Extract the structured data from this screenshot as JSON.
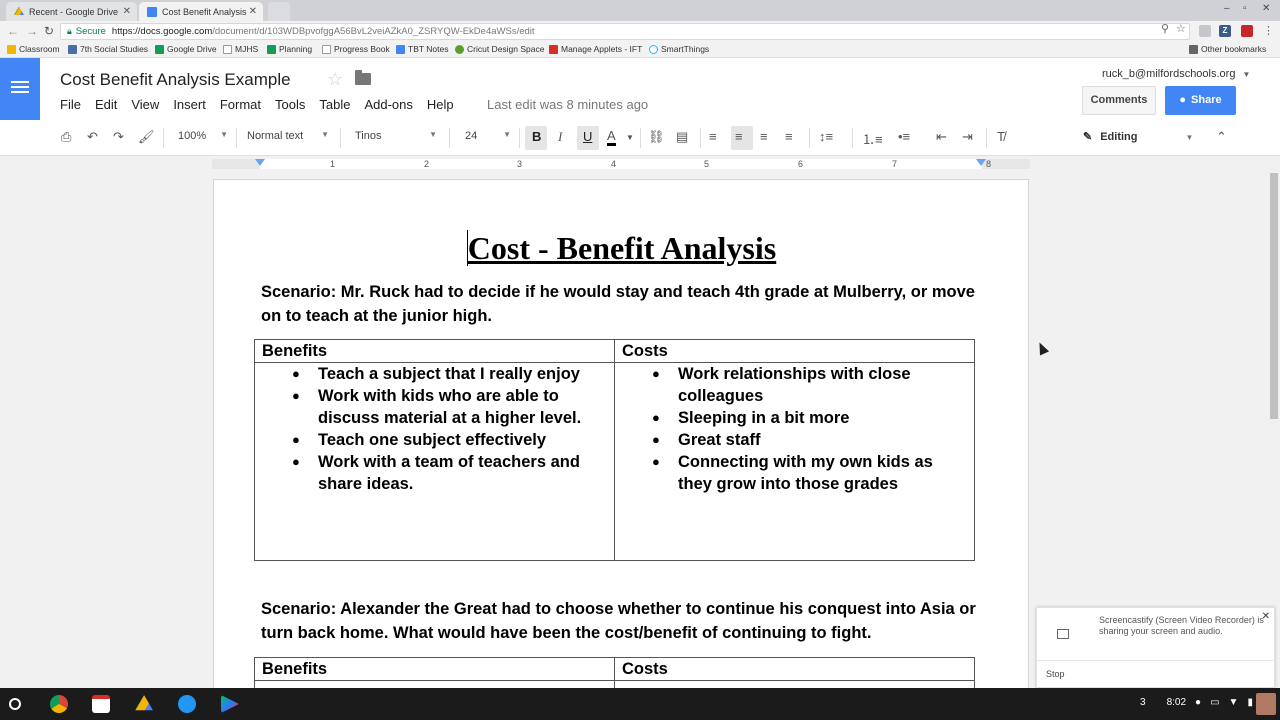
{
  "browser": {
    "tabs": [
      {
        "title": "Recent - Google Drive",
        "favicon": "google-drive-icon",
        "active": false
      },
      {
        "title": "Cost Benefit Analysis Ex",
        "favicon": "google-docs-icon",
        "active": true
      }
    ],
    "url_secure_label": "Secure",
    "url_host": "https://docs.google.com",
    "url_path": "/document/d/103WDBpvofggA56BvL2veiAZkA0_ZSRYQW-EkDe4aWSs/edit",
    "bookmarks": [
      {
        "label": "Classroom",
        "icon": "classroom-icon",
        "color": "#f4b400"
      },
      {
        "label": "7th Social Studies",
        "icon": "z-icon",
        "color": "#4a6fa5"
      },
      {
        "label": "Google Drive",
        "icon": "google-drive-icon",
        "color": "#0f9d58"
      },
      {
        "label": "MJHS",
        "icon": "page-icon",
        "color": "#9e9e9e"
      },
      {
        "label": "Planning",
        "icon": "google-drive-icon",
        "color": "#0f9d58"
      },
      {
        "label": "Progress Book",
        "icon": "page-icon",
        "color": "#9e9e9e"
      },
      {
        "label": "TBT Notes",
        "icon": "docs-icon",
        "color": "#4285f4"
      },
      {
        "label": "Cricut Design Space",
        "icon": "cricut-icon",
        "color": "#5aa02c"
      },
      {
        "label": "Manage Applets - IFT",
        "icon": "ifttt-icon",
        "color": "#d93025"
      },
      {
        "label": "SmartThings",
        "icon": "smartthings-icon",
        "color": "#15bfff"
      }
    ],
    "other_bookmarks": "Other bookmarks"
  },
  "docs": {
    "title": "Cost Benefit Analysis Example",
    "menu": [
      "File",
      "Edit",
      "View",
      "Insert",
      "Format",
      "Tools",
      "Table",
      "Add-ons",
      "Help"
    ],
    "last_edit": "Last edit was 8 minutes ago",
    "account": "ruck_b@milfordschools.org",
    "comments_label": "Comments",
    "share_label": "Share",
    "toolbar": {
      "zoom": "100%",
      "style": "Normal text",
      "font": "Tinos",
      "size": "24",
      "mode": "Editing"
    },
    "ruler_numbers": [
      "1",
      "2",
      "3",
      "4",
      "5",
      "6",
      "7",
      "8"
    ]
  },
  "document": {
    "heading": "Cost - Benefit Analysis",
    "scenario1": "Scenario:  Mr. Ruck had to decide if he would stay and teach 4th grade at Mulberry, or move on to teach at the junior high.",
    "table1": {
      "headers": [
        "Benefits",
        "Costs"
      ],
      "benefits": [
        "Teach a subject that I really enjoy",
        "Work with kids who are able to discuss material at a higher level.",
        "Teach one subject effectively",
        "Work with a team of teachers and share ideas."
      ],
      "costs": [
        "Work relationships with close colleagues",
        "Sleeping in a bit more",
        "Great staff",
        "Connecting with my own kids as they grow into those grades"
      ]
    },
    "scenario2": "Scenario:  Alexander the Great had to choose whether to continue his conquest into Asia or turn back home.  What would have been the cost/benefit of continuing to fight.",
    "table2": {
      "headers": [
        "Benefits",
        "Costs"
      ]
    }
  },
  "notification": {
    "message": "Screencastify (Screen Video Recorder) is sharing your screen and audio.",
    "stop_label": "Stop"
  },
  "shelf": {
    "notification_count": "3",
    "time": "8:02"
  }
}
